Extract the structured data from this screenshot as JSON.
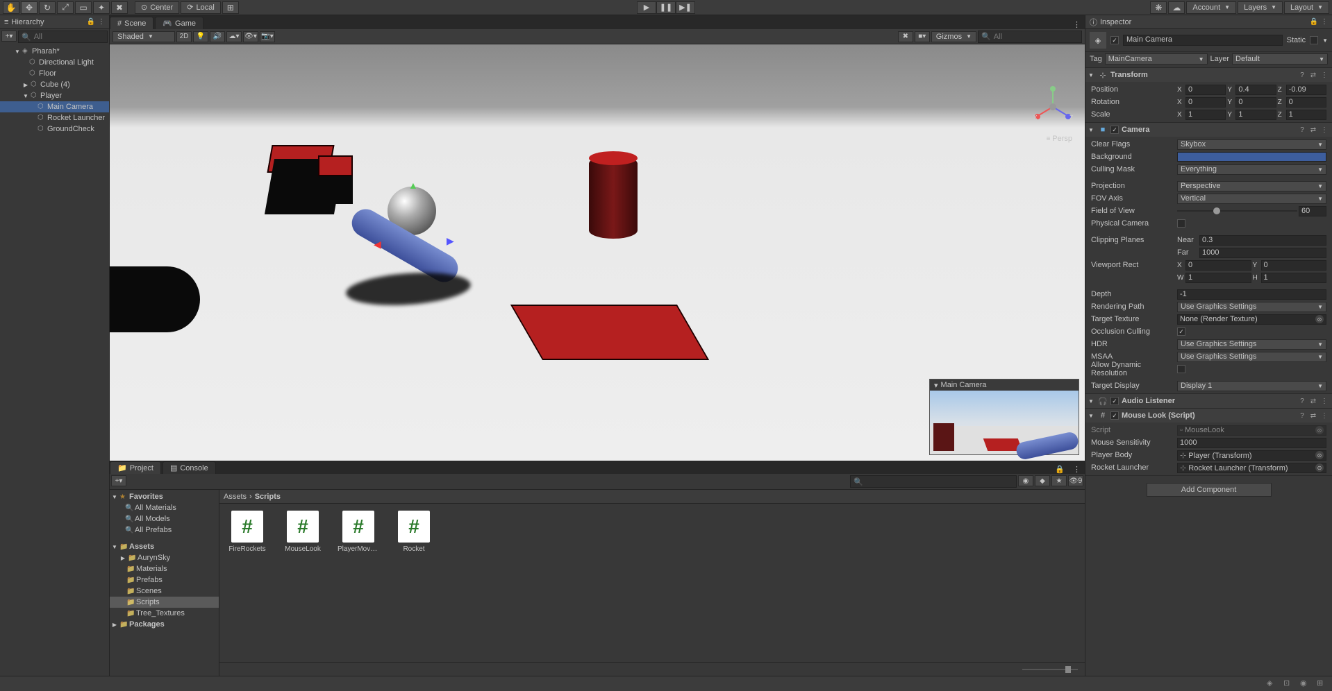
{
  "toolbar": {
    "center": "Center",
    "local": "Local",
    "account": "Account",
    "layers": "Layers",
    "layout": "Layout"
  },
  "hierarchy": {
    "title": "Hierarchy",
    "search_placeholder": "All",
    "scene": "Pharah*",
    "items": [
      "Directional Light",
      "Floor",
      "Cube (4)",
      "Player",
      "Main Camera",
      "Rocket Launcher",
      "GroundCheck"
    ]
  },
  "scene": {
    "tab1": "Scene",
    "tab2": "Game",
    "shading": "Shaded",
    "mode2d": "2D",
    "gizmos": "Gizmos",
    "search_placeholder": "All",
    "persp": "Persp",
    "camera_preview_title": "Main Camera"
  },
  "project": {
    "tab1": "Project",
    "tab2": "Console",
    "favorites": "Favorites",
    "fav_items": [
      "All Materials",
      "All Models",
      "All Prefabs"
    ],
    "assets": "Assets",
    "asset_folders": [
      "AurynSky",
      "Materials",
      "Prefabs",
      "Scenes",
      "Scripts",
      "Tree_Textures"
    ],
    "packages": "Packages",
    "breadcrumb_root": "Assets",
    "breadcrumb_current": "Scripts",
    "files": [
      "FireRockets",
      "MouseLook",
      "PlayerMove...",
      "Rocket"
    ],
    "count": "9"
  },
  "inspector": {
    "title": "Inspector",
    "obj_name": "Main Camera",
    "static": "Static",
    "tag_label": "Tag",
    "tag_value": "MainCamera",
    "layer_label": "Layer",
    "layer_value": "Default",
    "transform": {
      "title": "Transform",
      "position": "Position",
      "px": "0",
      "py": "0.4",
      "pz": "-0.09",
      "rotation": "Rotation",
      "rx": "0",
      "ry": "0",
      "rz": "0",
      "scale": "Scale",
      "sx": "1",
      "sy": "1",
      "sz": "1"
    },
    "camera": {
      "title": "Camera",
      "clear_flags": "Clear Flags",
      "clear_flags_v": "Skybox",
      "background": "Background",
      "culling": "Culling Mask",
      "culling_v": "Everything",
      "projection": "Projection",
      "projection_v": "Perspective",
      "fov_axis": "FOV Axis",
      "fov_axis_v": "Vertical",
      "fov": "Field of View",
      "fov_v": "60",
      "physical": "Physical Camera",
      "clipping": "Clipping Planes",
      "near": "Near",
      "near_v": "0.3",
      "far": "Far",
      "far_v": "1000",
      "viewport": "Viewport Rect",
      "vx": "0",
      "vy": "0",
      "vw": "1",
      "vh": "1",
      "depth": "Depth",
      "depth_v": "-1",
      "rendering": "Rendering Path",
      "rendering_v": "Use Graphics Settings",
      "target_tex": "Target Texture",
      "target_tex_v": "None (Render Texture)",
      "occlusion": "Occlusion Culling",
      "hdr": "HDR",
      "hdr_v": "Use Graphics Settings",
      "msaa": "MSAA",
      "msaa_v": "Use Graphics Settings",
      "dynamic_res": "Allow Dynamic Resolution",
      "target_display": "Target Display",
      "target_display_v": "Display 1"
    },
    "audio": {
      "title": "Audio Listener"
    },
    "mouselook": {
      "title": "Mouse Look (Script)",
      "script": "Script",
      "script_v": "MouseLook",
      "sensitivity": "Mouse Sensitivity",
      "sensitivity_v": "1000",
      "player_body": "Player Body",
      "player_body_v": "Player (Transform)",
      "rocket_launcher": "Rocket Launcher",
      "rocket_launcher_v": "Rocket Launcher (Transform)"
    },
    "add_component": "Add Component"
  }
}
